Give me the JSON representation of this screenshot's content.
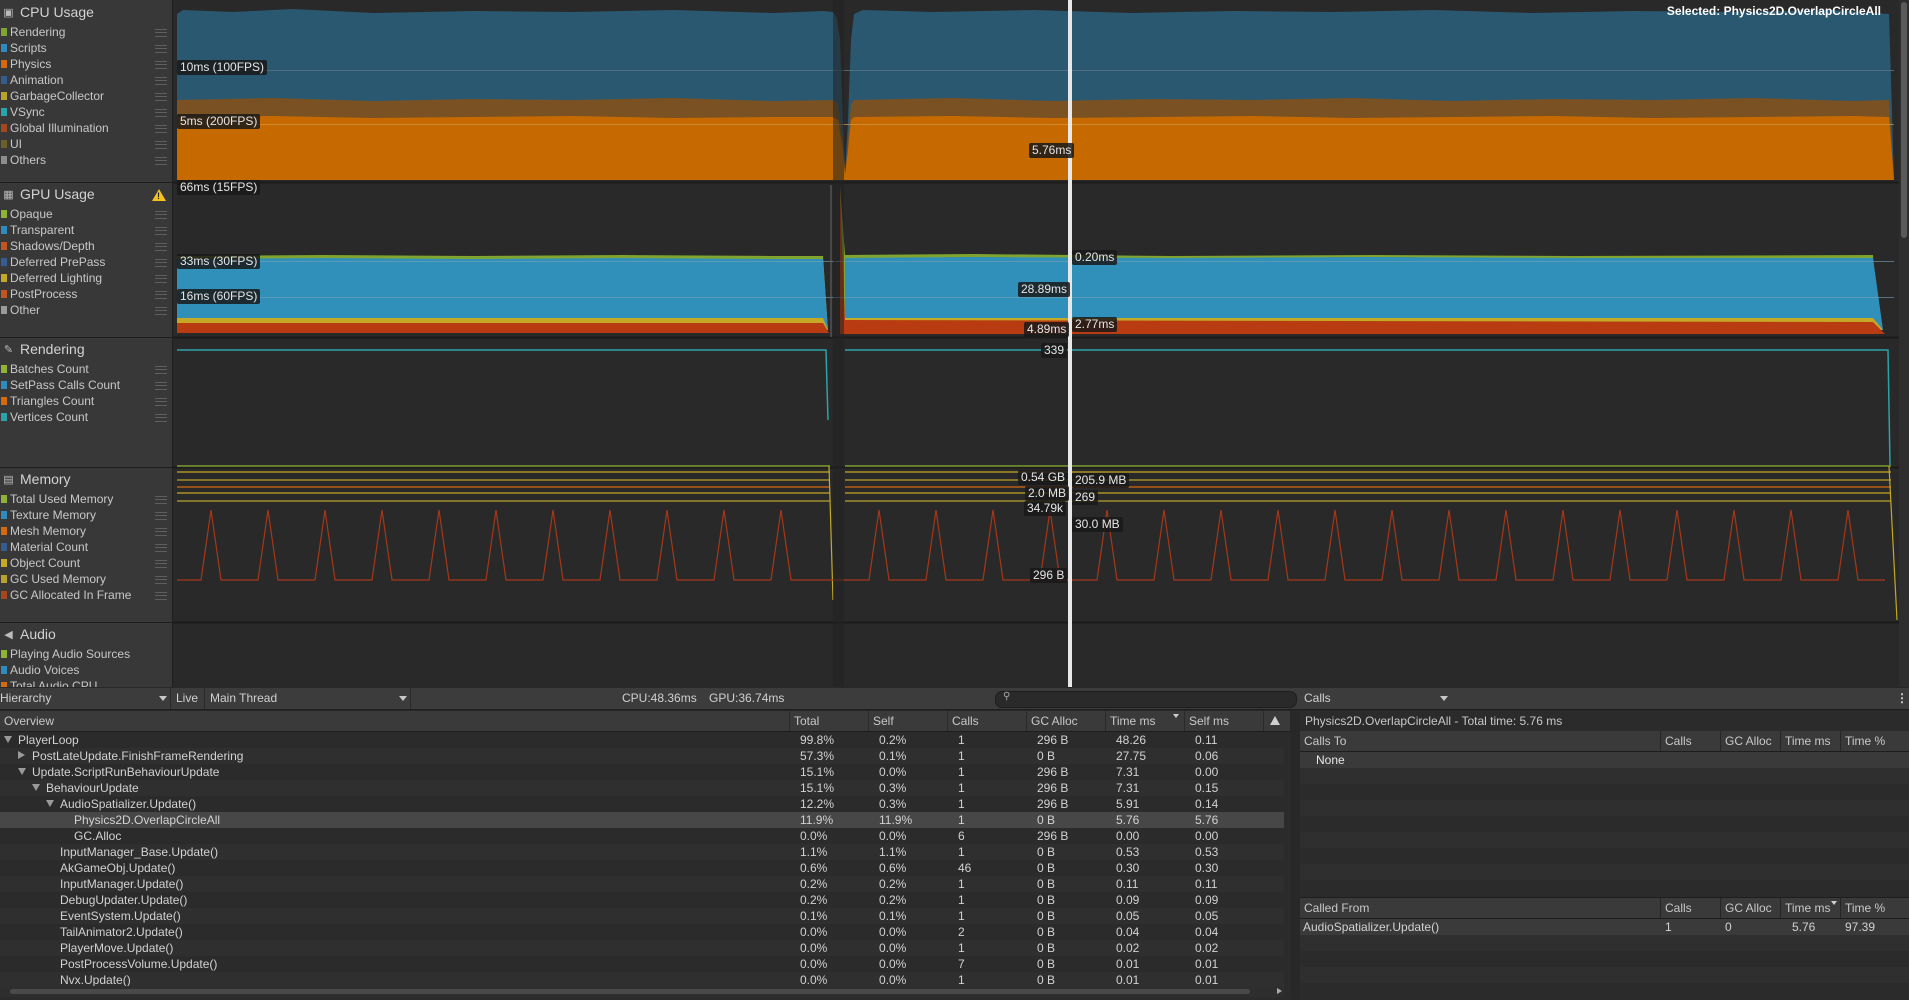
{
  "modules": {
    "cpu": {
      "title": "CPU Usage",
      "icon": "cpu-icon",
      "items": [
        {
          "label": "Rendering",
          "color": "#7fa42f"
        },
        {
          "label": "Scripts",
          "color": "#2f8bbd"
        },
        {
          "label": "Physics",
          "color": "#d46a0e"
        },
        {
          "label": "Animation",
          "color": "#345e92"
        },
        {
          "label": "GarbageCollector",
          "color": "#b8a229"
        },
        {
          "label": "VSync",
          "color": "#2aa3aa"
        },
        {
          "label": "Global Illumination",
          "color": "#a5471a"
        },
        {
          "label": "UI",
          "color": "#6d5f29"
        },
        {
          "label": "Others",
          "color": "#8d8d8d"
        }
      ]
    },
    "gpu": {
      "title": "GPU Usage",
      "icon": "gpu-icon",
      "warning_icon": "warning-icon",
      "items": [
        {
          "label": "Opaque",
          "color": "#8fb334"
        },
        {
          "label": "Transparent",
          "color": "#2f8bbd"
        },
        {
          "label": "Shadows/Depth",
          "color": "#c2541d"
        },
        {
          "label": "Deferred PrePass",
          "color": "#345e92"
        },
        {
          "label": "Deferred Lighting",
          "color": "#c4a826"
        },
        {
          "label": "PostProcess",
          "color": "#c2541d"
        },
        {
          "label": "Other",
          "color": "#9a9a9a"
        }
      ]
    },
    "rendering": {
      "title": "Rendering",
      "icon": "rendering-icon",
      "items": [
        {
          "label": "Batches Count",
          "color": "#8fb334"
        },
        {
          "label": "SetPass Calls Count",
          "color": "#2f8bbd"
        },
        {
          "label": "Triangles Count",
          "color": "#d46a0e"
        },
        {
          "label": "Vertices Count",
          "color": "#2aa3aa"
        }
      ]
    },
    "memory": {
      "title": "Memory",
      "icon": "memory-icon",
      "items": [
        {
          "label": "Total Used Memory",
          "color": "#8fb334"
        },
        {
          "label": "Texture Memory",
          "color": "#2f8bbd"
        },
        {
          "label": "Mesh Memory",
          "color": "#d46a0e"
        },
        {
          "label": "Material Count",
          "color": "#345e92"
        },
        {
          "label": "Object Count",
          "color": "#c4a826"
        },
        {
          "label": "GC Used Memory",
          "color": "#b8a229"
        },
        {
          "label": "GC Allocated In Frame",
          "color": "#a5471a"
        }
      ]
    },
    "audio": {
      "title": "Audio",
      "icon": "audio-icon",
      "items": [
        {
          "label": "Playing Audio Sources",
          "color": "#8fb334"
        },
        {
          "label": "Audio Voices",
          "color": "#2f8bbd"
        },
        {
          "label": "Total Audio CPU",
          "color": "#d46a0e"
        }
      ]
    }
  },
  "charts": {
    "selected_label": "Selected: Physics2D.OverlapCircleAll",
    "cpu_labels": {
      "fps100": "10ms (100FPS)",
      "fps200": "5ms (200FPS)",
      "value": "5.76ms"
    },
    "gpu_labels": {
      "fps15": "66ms (15FPS)",
      "fps30": "33ms (30FPS)",
      "fps60": "16ms (60FPS)",
      "v1": "0.20ms",
      "v2": "28.89ms",
      "v3": "4.89ms",
      "v4": "2.77ms"
    },
    "rendering_labels": {
      "v1": "339"
    },
    "memory_labels": {
      "v1": "0.54 GB",
      "v2": "205.9 MB",
      "v3": "2.0 MB",
      "v4": "269",
      "v5": "34.79k",
      "v6": "30.0 MB",
      "v7": "296 B"
    }
  },
  "toolbar": {
    "view_mode": "Hierarchy",
    "live": "Live",
    "thread": "Main Thread",
    "cpu_stat": "CPU:48.36ms",
    "gpu_stat": "GPU:36.74ms",
    "search_placeholder": "",
    "right_mode": "Calls"
  },
  "table": {
    "columns": [
      "Overview",
      "Total",
      "Self",
      "Calls",
      "GC Alloc",
      "Time ms",
      "Self ms"
    ],
    "rows": [
      {
        "name": "PlayerLoop",
        "depth": 0,
        "toggle": "open",
        "total": "99.8%",
        "self": "0.2%",
        "calls": "1",
        "gc": "296 B",
        "time": "48.26",
        "selfms": "0.11"
      },
      {
        "name": "PostLateUpdate.FinishFrameRendering",
        "depth": 1,
        "toggle": "closed",
        "total": "57.3%",
        "self": "0.1%",
        "calls": "1",
        "gc": "0 B",
        "time": "27.75",
        "selfms": "0.06"
      },
      {
        "name": "Update.ScriptRunBehaviourUpdate",
        "depth": 1,
        "toggle": "open",
        "total": "15.1%",
        "self": "0.0%",
        "calls": "1",
        "gc": "296 B",
        "time": "7.31",
        "selfms": "0.00"
      },
      {
        "name": "BehaviourUpdate",
        "depth": 2,
        "toggle": "open",
        "total": "15.1%",
        "self": "0.3%",
        "calls": "1",
        "gc": "296 B",
        "time": "7.31",
        "selfms": "0.15"
      },
      {
        "name": "AudioSpatializer.Update()",
        "depth": 3,
        "toggle": "open",
        "total": "12.2%",
        "self": "0.3%",
        "calls": "1",
        "gc": "296 B",
        "time": "5.91",
        "selfms": "0.14"
      },
      {
        "name": "Physics2D.OverlapCircleAll",
        "depth": 4,
        "toggle": "",
        "total": "11.9%",
        "self": "11.9%",
        "calls": "1",
        "gc": "0 B",
        "time": "5.76",
        "selfms": "5.76",
        "selected": true
      },
      {
        "name": "GC.Alloc",
        "depth": 4,
        "toggle": "",
        "total": "0.0%",
        "self": "0.0%",
        "calls": "6",
        "gc": "296 B",
        "time": "0.00",
        "selfms": "0.00"
      },
      {
        "name": "InputManager_Base.Update()",
        "depth": 3,
        "toggle": "",
        "total": "1.1%",
        "self": "1.1%",
        "calls": "1",
        "gc": "0 B",
        "time": "0.53",
        "selfms": "0.53"
      },
      {
        "name": "AkGameObj.Update()",
        "depth": 3,
        "toggle": "",
        "total": "0.6%",
        "self": "0.6%",
        "calls": "46",
        "gc": "0 B",
        "time": "0.30",
        "selfms": "0.30"
      },
      {
        "name": "InputManager.Update()",
        "depth": 3,
        "toggle": "",
        "total": "0.2%",
        "self": "0.2%",
        "calls": "1",
        "gc": "0 B",
        "time": "0.11",
        "selfms": "0.11"
      },
      {
        "name": "DebugUpdater.Update()",
        "depth": 3,
        "toggle": "",
        "total": "0.2%",
        "self": "0.2%",
        "calls": "1",
        "gc": "0 B",
        "time": "0.09",
        "selfms": "0.09"
      },
      {
        "name": "EventSystem.Update()",
        "depth": 3,
        "toggle": "",
        "total": "0.1%",
        "self": "0.1%",
        "calls": "1",
        "gc": "0 B",
        "time": "0.05",
        "selfms": "0.05"
      },
      {
        "name": "TailAnimator2.Update()",
        "depth": 3,
        "toggle": "",
        "total": "0.0%",
        "self": "0.0%",
        "calls": "2",
        "gc": "0 B",
        "time": "0.04",
        "selfms": "0.04"
      },
      {
        "name": "PlayerMove.Update()",
        "depth": 3,
        "toggle": "",
        "total": "0.0%",
        "self": "0.0%",
        "calls": "1",
        "gc": "0 B",
        "time": "0.02",
        "selfms": "0.02"
      },
      {
        "name": "PostProcessVolume.Update()",
        "depth": 3,
        "toggle": "",
        "total": "0.0%",
        "self": "0.0%",
        "calls": "7",
        "gc": "0 B",
        "time": "0.01",
        "selfms": "0.01"
      },
      {
        "name": "Nvx.Update()",
        "depth": 3,
        "toggle": "",
        "total": "0.0%",
        "self": "0.0%",
        "calls": "1",
        "gc": "0 B",
        "time": "0.01",
        "selfms": "0.01"
      }
    ]
  },
  "calls_panel": {
    "summary": "Physics2D.OverlapCircleAll - Total time: 5.76 ms",
    "calls_to": {
      "columns": [
        "Calls To",
        "Calls",
        "GC Alloc",
        "Time ms",
        "Time %"
      ],
      "rows": [
        {
          "name": "None"
        }
      ]
    },
    "called_from": {
      "columns": [
        "Called From",
        "Calls",
        "GC Alloc",
        "Time ms",
        "Time %"
      ],
      "rows": [
        {
          "name": "AudioSpatializer.Update()",
          "calls": "1",
          "gc": "0",
          "time": "5.76",
          "pct": "97.39"
        }
      ]
    }
  }
}
